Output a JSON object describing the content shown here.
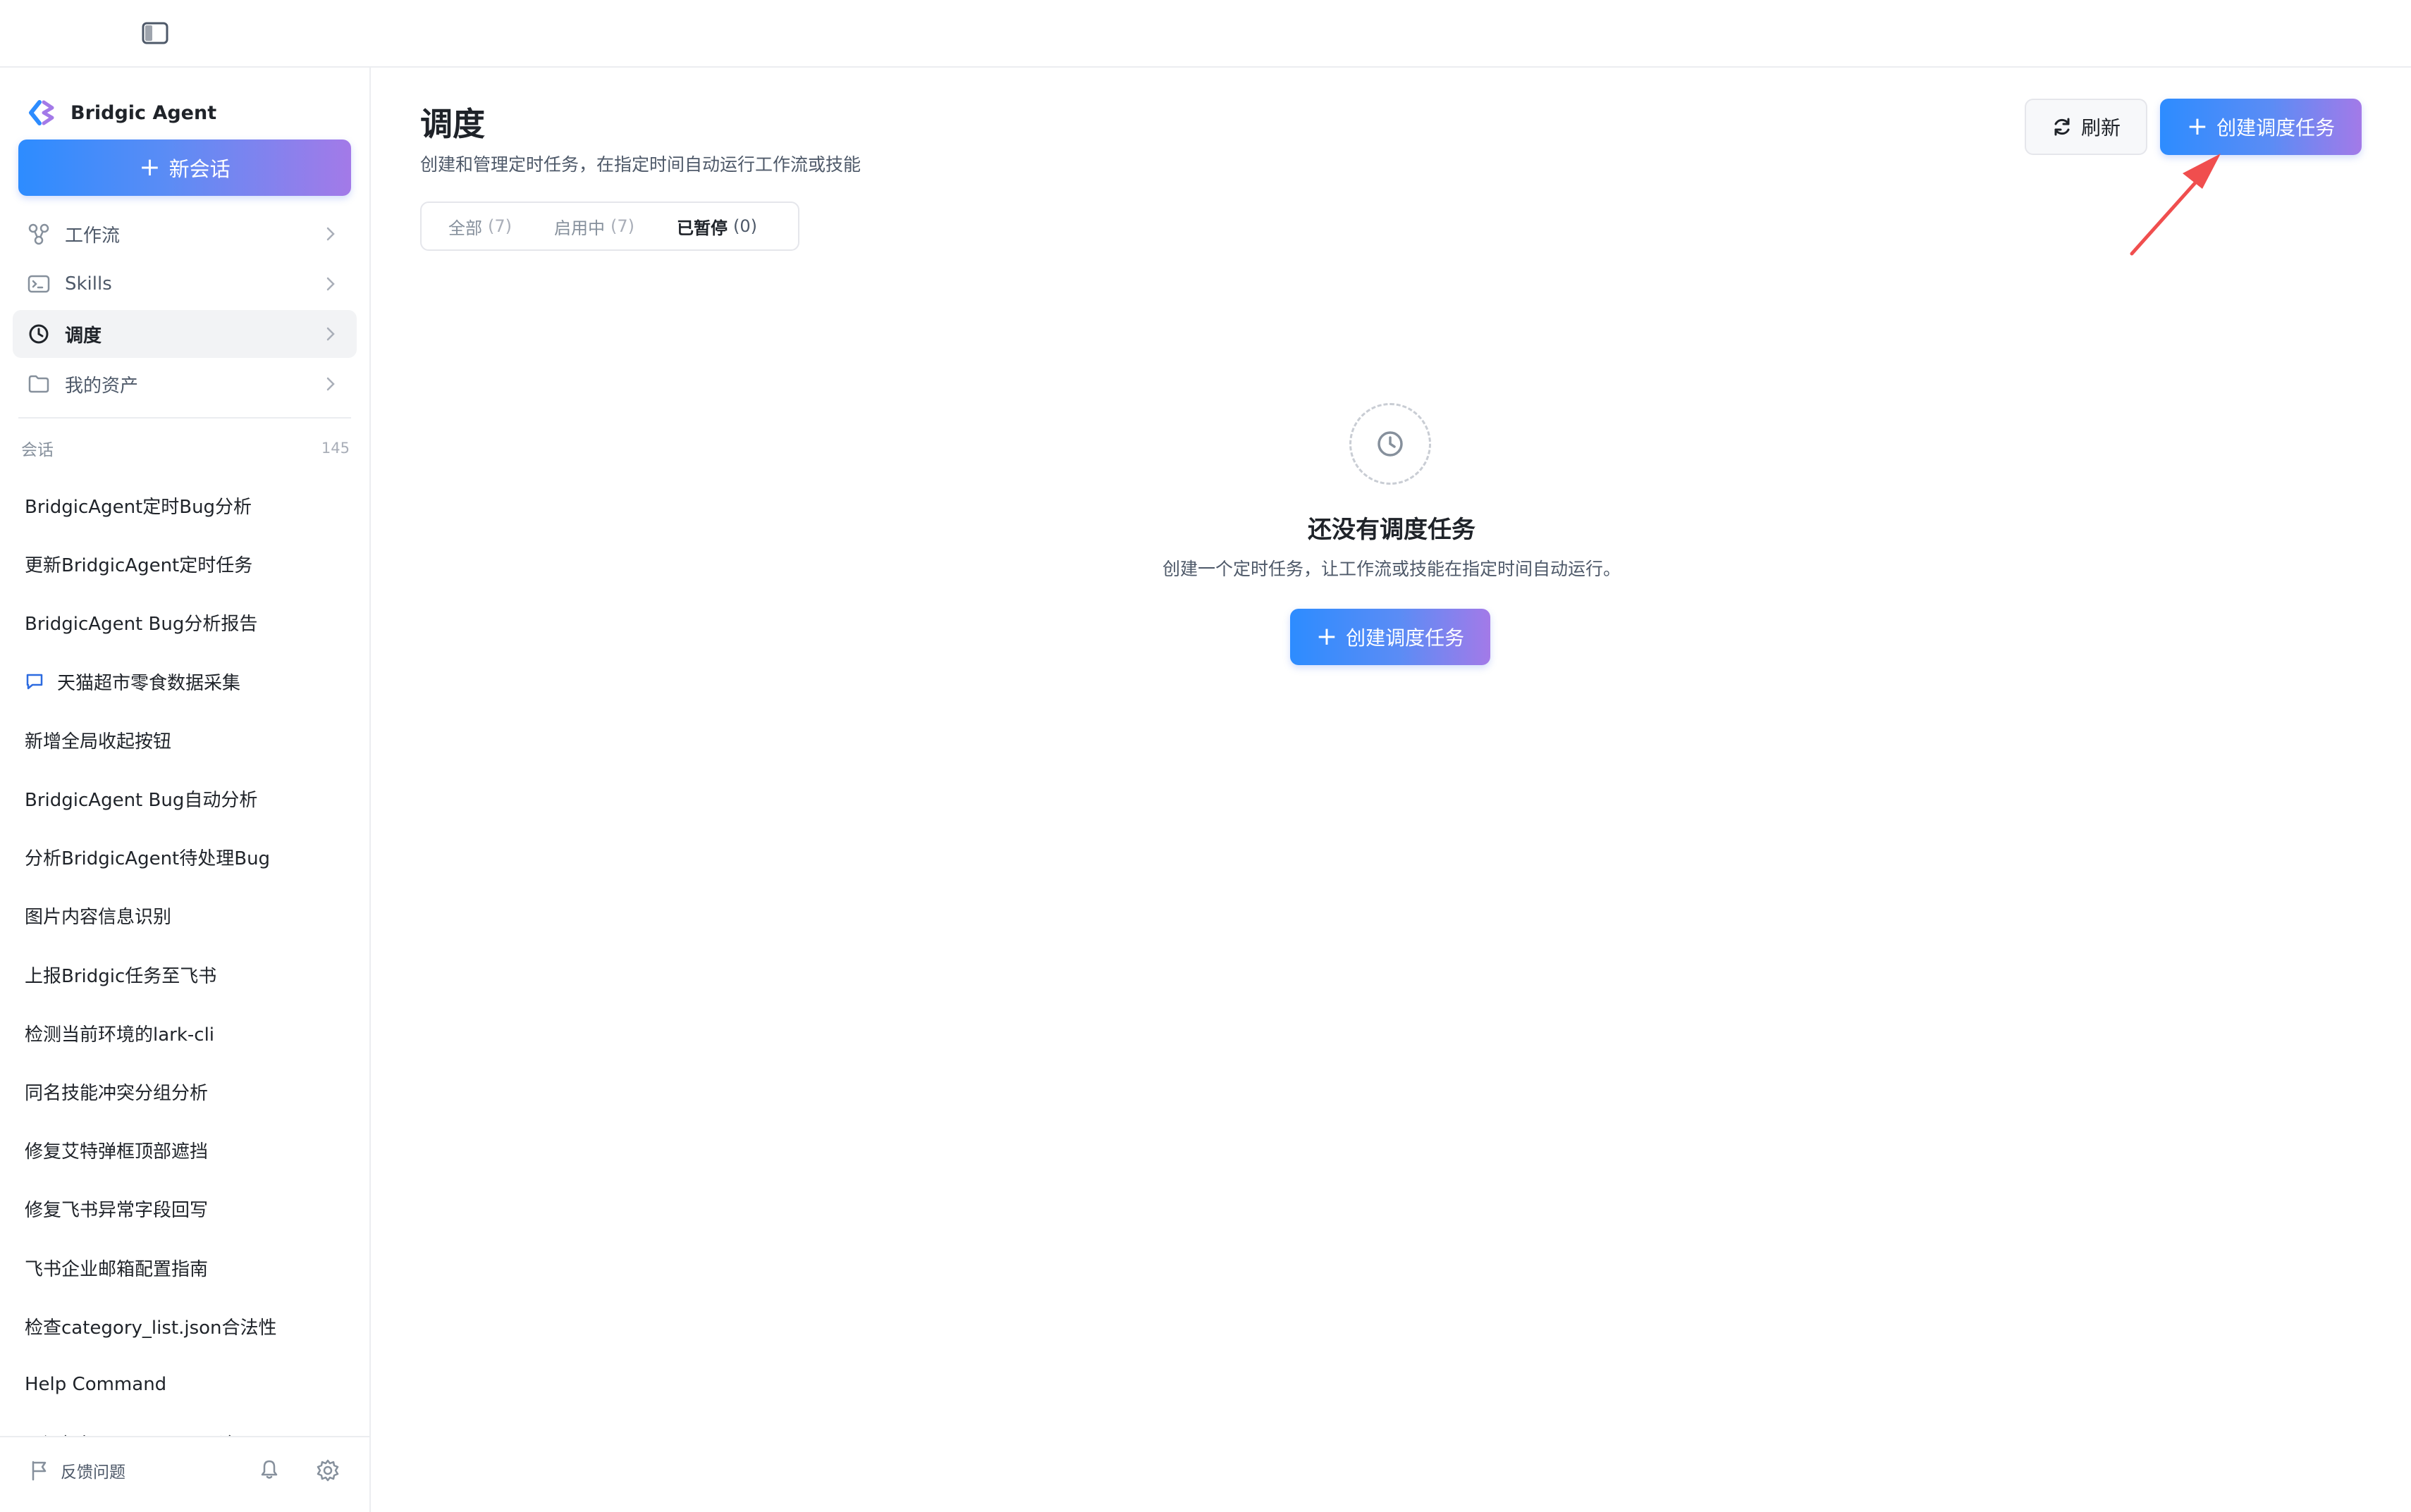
{
  "brand": {
    "name": "Bridgic Agent"
  },
  "sidebar": {
    "new_chat_label": "新会话",
    "nav": [
      {
        "label": "工作流",
        "icon": "workflow-icon"
      },
      {
        "label": "Skills",
        "icon": "terminal-icon"
      },
      {
        "label": "调度",
        "icon": "clock-icon",
        "active": true
      },
      {
        "label": "我的资产",
        "icon": "folder-icon"
      }
    ],
    "conversations_title": "会话",
    "conversations_count": "145",
    "conversations": [
      "BridgicAgent定时Bug分析",
      "更新BridgicAgent定时任务",
      "BridgicAgent Bug分析报告",
      "天猫超市零食数据采集",
      "新增全局收起按钮",
      "BridgicAgent Bug自动分析",
      "分析BridgicAgent待处理Bug",
      "图片内容信息识别",
      "上报Bridgic任务至飞书",
      "检测当前环境的lark-cli",
      "同名技能冲突分组分析",
      "修复艾特弹框顶部遮挡",
      "修复飞书异常字段回写",
      "飞书企业邮箱配置指南",
      "检查category_list.json合法性",
      "Help Command",
      "开源框架 Telemetry 用途"
    ],
    "feedback_label": "反馈问题"
  },
  "main": {
    "title": "调度",
    "subtitle": "创建和管理定时任务，在指定时间自动运行工作流或技能",
    "refresh_label": "刷新",
    "create_label": "创建调度任务",
    "tabs": [
      {
        "label": "全部",
        "count": "(7)"
      },
      {
        "label": "启用中",
        "count": "(7)"
      },
      {
        "label": "已暂停",
        "count": "(0)",
        "active": true
      }
    ],
    "empty": {
      "title": "还没有调度任务",
      "description": "创建一个定时任务，让工作流或技能在指定时间自动运行。",
      "button_label": "创建调度任务"
    }
  },
  "colors": {
    "accent_start": "#2d8cff",
    "accent_end": "#a37ae8",
    "annotation_arrow": "#f04e4e"
  }
}
